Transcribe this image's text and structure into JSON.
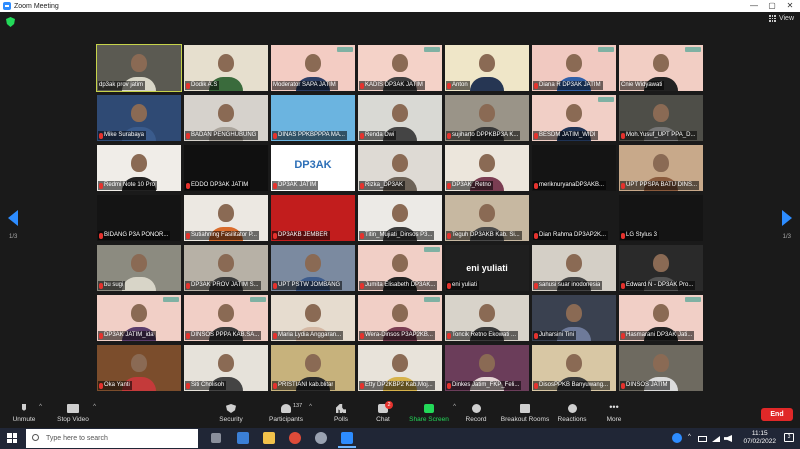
{
  "window": {
    "title": "Zoom Meeting",
    "controls": [
      "—",
      "▢",
      "✕"
    ]
  },
  "header": {
    "view_label": "View"
  },
  "pagination": {
    "left": "1/3",
    "right": "1/3"
  },
  "participants": [
    {
      "name": "dp3ak prov jatim",
      "muted": false,
      "bg": "#5b5a52",
      "active": true,
      "shirt": "#d8d6c7"
    },
    {
      "name": "Dodik A.S",
      "muted": true,
      "bg": "#e6dfce",
      "shirt": "#3a6b3c"
    },
    {
      "name": "Moderator SAPA JATIM",
      "muted": false,
      "bg": "#f3ccc3",
      "shirt": "#2c3e66"
    },
    {
      "name": "KADIS DP3AK JATIM",
      "muted": true,
      "bg": "#f4d2c8",
      "shirt": "#3e3e3e"
    },
    {
      "name": "Anton",
      "muted": true,
      "bg": "#efe6c8",
      "shirt": "#263653"
    },
    {
      "name": "Diana R DP3AK JATIM",
      "muted": true,
      "bg": "#f1c9c1",
      "shirt": "#2f5fa8"
    },
    {
      "name": "Cnie Widyawati",
      "muted": false,
      "bg": "#f2cec4",
      "shirt": "#222222"
    },
    {
      "name": "Mike Surabaya",
      "muted": true,
      "bg": "#2f4a74",
      "shirt": "#3a5b8c"
    },
    {
      "name": "BADAN PENGHUBUNG",
      "muted": true,
      "bg": "#d6d2cc",
      "shirt": "#a9a39a"
    },
    {
      "name": "DINAS PPKBPPPA MA...",
      "muted": true,
      "bg": "#6bb4e0",
      "shirt": "#6bb4e0"
    },
    {
      "name": "Renda Dwi",
      "muted": true,
      "bg": "#d9d9d4",
      "shirt": "#444444"
    },
    {
      "name": "sujiharto DPPKBP3A K...",
      "muted": true,
      "bg": "#9a9488",
      "shirt": "#373737"
    },
    {
      "name": "BESDM JATIM_WIDI",
      "muted": true,
      "bg": "#f1cfc6",
      "shirt": "#1f3355"
    },
    {
      "name": "Moh.Yusuf_UPT PPA_D...",
      "muted": true,
      "bg": "#4e4e48",
      "shirt": "#777777"
    },
    {
      "name": "Redmi Note 10 Pro",
      "muted": true,
      "bg": "#f0ede8",
      "shirt": "#222222"
    },
    {
      "name": "EDDO DP3AK JATIM",
      "muted": true,
      "bg": "#101010",
      "shirt": "#101010"
    },
    {
      "name": "DP3AK JATIM",
      "muted": true,
      "bg": "#ffffff",
      "shirt": "#ffffff",
      "bigname": "DP3AK"
    },
    {
      "name": "Rizka_DP3AK",
      "muted": true,
      "bg": "#dedad4",
      "shirt": "#6c6257"
    },
    {
      "name": "DP3AK_Retno",
      "muted": true,
      "bg": "#ece6dc",
      "shirt": "#7a3d52"
    },
    {
      "name": "meriknuryanaDP3AKB...",
      "muted": true,
      "bg": "#141414",
      "shirt": "#141414"
    },
    {
      "name": "UPT PPSPA BATU DINS...",
      "muted": true,
      "bg": "#c8a98a",
      "shirt": "#8a5a3c"
    },
    {
      "name": "BIDANG P3A PONOR...",
      "muted": true,
      "bg": "#141414",
      "shirt": "#141414"
    },
    {
      "name": "Sutiahning Fasilitator P...",
      "muted": true,
      "bg": "#ece8e2",
      "shirt": "#d96b2b"
    },
    {
      "name": "DP3AKB JEMBER",
      "muted": true,
      "bg": "#c21d1d",
      "shirt": "#c21d1d"
    },
    {
      "name": "Titin_Mujiati_Dinsos P3...",
      "muted": true,
      "bg": "#eceae6",
      "shirt": "#3a3a3a"
    },
    {
      "name": "Teguh DP3AKB Kab. Si...",
      "muted": true,
      "bg": "#c7b8a1",
      "shirt": "#4a4a4a"
    },
    {
      "name": "Dian Rahma DP3AP2K...",
      "muted": true,
      "bg": "#1a1a1a",
      "shirt": "#1a1a1a"
    },
    {
      "name": "LG Stylus 3",
      "muted": true,
      "bg": "#141414",
      "shirt": "#141414"
    },
    {
      "name": "bu sugi",
      "muted": true,
      "bg": "#8c8b80",
      "shirt": "#d8d5c8"
    },
    {
      "name": "DP3AK PROV JATIM S...",
      "muted": true,
      "bg": "#b7b1a6",
      "shirt": "#3c3c3c"
    },
    {
      "name": "UPT PSTW JOMBANG",
      "muted": true,
      "bg": "#7b8aa0",
      "shirt": "#3c5b8c"
    },
    {
      "name": "Jumita Elisabeth DP3AK...",
      "muted": true,
      "bg": "#f1cfc6",
      "shirt": "#222222"
    },
    {
      "name": "eni yuliati",
      "muted": true,
      "bg": "#1f1f1f",
      "shirt": "#1f1f1f",
      "bigname": "eni yuliati"
    },
    {
      "name": "sanusi suar inodonesia",
      "muted": true,
      "bg": "#d4cfc6",
      "shirt": "#444444"
    },
    {
      "name": "Edward N - DP3AK Pro...",
      "muted": true,
      "bg": "#2a2a2a",
      "shirt": "#555555"
    },
    {
      "name": "DP3AK JATIM_ida",
      "muted": true,
      "bg": "#f1cfc6",
      "shirt": "#5a3c6b"
    },
    {
      "name": "DINSOS PPPA KAB.SA...",
      "muted": true,
      "bg": "#f1cfc6",
      "shirt": "#3a3a3a"
    },
    {
      "name": "Maria Lydia Anggaran...",
      "muted": true,
      "bg": "#e6dccf",
      "shirt": "#d4b8a4"
    },
    {
      "name": "Wera-Dinsos P3AP2KB...",
      "muted": true,
      "bg": "#f1cfc6",
      "shirt": "#7a3d52"
    },
    {
      "name": "Toncik Retno Ekowati ...",
      "muted": true,
      "bg": "#d8d3ca",
      "shirt": "#3a3a3a"
    },
    {
      "name": "Juharsini Tini",
      "muted": true,
      "bg": "#3a4150",
      "shirt": "#6e7a9a"
    },
    {
      "name": "Hasmarani DP3AK Jati...",
      "muted": true,
      "bg": "#f1cfc6",
      "shirt": "#222222"
    },
    {
      "name": "Oka Yanti",
      "muted": true,
      "bg": "#7b4d2c",
      "shirt": "#c43a3a"
    },
    {
      "name": "Siti Cholisoh",
      "muted": true,
      "bg": "#e6e2da",
      "shirt": "#444444"
    },
    {
      "name": "PRISTIANI kab.blitar",
      "muted": true,
      "bg": "#c7b27c",
      "shirt": "#2b2b2b"
    },
    {
      "name": "Etty DP2KBP2 Kab.Moj...",
      "muted": true,
      "bg": "#e8e3da",
      "shirt": "#d6b24a"
    },
    {
      "name": "Dinkes Jatim_FKP_Feli...",
      "muted": true,
      "bg": "#6b3d5a",
      "shirt": "#e6d6d6"
    },
    {
      "name": "DisosPPKB Banyuwang...",
      "muted": true,
      "bg": "#d8c7a4",
      "shirt": "#3a3a3a"
    },
    {
      "name": "DINSOS JATIM",
      "muted": true,
      "bg": "#6e6a60",
      "shirt": "#dcdcdc"
    }
  ],
  "toolbar": {
    "unmute": "Unmute",
    "stop_video": "Stop Video",
    "security": "Security",
    "participants": "Participants",
    "participants_count": "137",
    "polls": "Polls",
    "chat": "Chat",
    "chat_badge": "2",
    "share_screen": "Share Screen",
    "record": "Record",
    "breakout_rooms": "Breakout Rooms",
    "reactions": "Reactions",
    "more": "More",
    "end": "End"
  },
  "taskbar": {
    "search_placeholder": "Type here to search",
    "time": "11:15",
    "date": "07/02/2022",
    "notification_count": "3"
  },
  "colors": {
    "accent": "#2d8cff",
    "share": "#23d959",
    "end": "#e02828",
    "muted": "#e5322d",
    "active_speaker": "#c6d34a"
  }
}
